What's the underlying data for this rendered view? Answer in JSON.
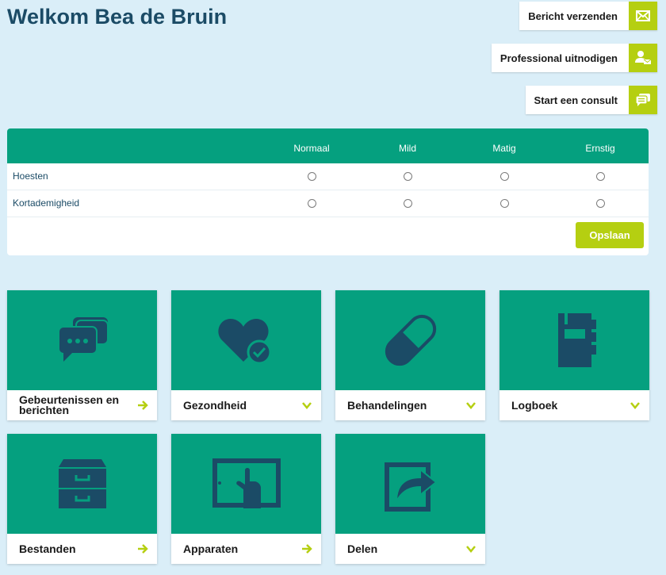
{
  "header": {
    "title": "Welkom Bea de Bruin"
  },
  "actions": [
    {
      "label": "Bericht verzenden",
      "icon": "envelope-icon"
    },
    {
      "label": "Professional uitnodigen",
      "icon": "user-invite-icon"
    },
    {
      "label": "Start een consult",
      "icon": "chat-icon"
    }
  ],
  "symptoms": {
    "columns": [
      "Normaal",
      "Mild",
      "Matig",
      "Ernstig"
    ],
    "rows": [
      "Hoesten",
      "Kortademigheid"
    ],
    "save_label": "Opslaan"
  },
  "tiles": [
    {
      "label": "Gebeurtenissen en berichten",
      "icon": "chat-bubbles-icon",
      "arrow": "right"
    },
    {
      "label": "Gezondheid",
      "icon": "heart-check-icon",
      "arrow": "down"
    },
    {
      "label": "Behandelingen",
      "icon": "pill-icon",
      "arrow": "down"
    },
    {
      "label": "Logboek",
      "icon": "notebook-icon",
      "arrow": "down"
    },
    {
      "label": "Bestanden",
      "icon": "file-cabinet-icon",
      "arrow": "right"
    },
    {
      "label": "Apparaten",
      "icon": "tablet-touch-icon",
      "arrow": "right"
    },
    {
      "label": "Delen",
      "icon": "share-icon",
      "arrow": "down"
    }
  ],
  "colors": {
    "teal": "#05a07f",
    "lime": "#b5cf11",
    "navy": "#1b4b66",
    "background": "#daeef8"
  }
}
